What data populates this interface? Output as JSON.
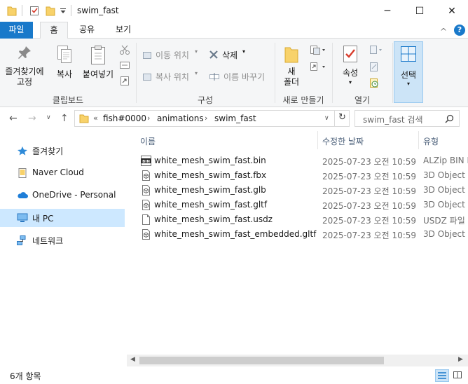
{
  "window": {
    "title": "swim_fast",
    "controls": {
      "minimize": "─",
      "maximize": "☐",
      "close": "✕"
    }
  },
  "ribbon": {
    "tabs": [
      {
        "label": "파일"
      },
      {
        "label": "홈"
      },
      {
        "label": "공유"
      },
      {
        "label": "보기"
      }
    ],
    "collapse_label": "^",
    "help_label": "?",
    "groups": {
      "clipboard": {
        "label": "클립보드",
        "pin": [
          "즐겨찾기에",
          "고정"
        ],
        "copy": "복사",
        "paste": "붙여넣기"
      },
      "organize": {
        "label": "구성",
        "move_to": "이동 위치",
        "copy_to": "복사 위치",
        "delete": "삭제",
        "rename": "이름 바꾸기"
      },
      "new": {
        "label": "새로 만들기",
        "new_folder": [
          "새",
          "폴더"
        ]
      },
      "open": {
        "label": "열기",
        "properties": "속성"
      },
      "select": {
        "label": "선택"
      }
    }
  },
  "address": {
    "overflow": "«",
    "crumbs": [
      "fish#0000",
      "animations",
      "swim_fast"
    ],
    "search_placeholder": "swim_fast 검색"
  },
  "sidebar": {
    "items": [
      {
        "label": "즐겨찾기",
        "icon": "star-icon"
      },
      {
        "label": "Naver Cloud",
        "icon": "drive-icon"
      },
      {
        "label": "OneDrive - Personal",
        "icon": "cloud-icon"
      },
      {
        "label": "내 PC",
        "icon": "pc-icon",
        "selected": true
      },
      {
        "label": "네트워크",
        "icon": "network-icon"
      }
    ]
  },
  "files": {
    "columns": {
      "name": "이름",
      "date": "수정한 날짜",
      "type": "유형"
    },
    "rows": [
      {
        "name": "white_mesh_swim_fast.bin",
        "date": "2025-07-23 오전 10:59",
        "type": "ALZip BIN File",
        "icon": "bin-file-icon"
      },
      {
        "name": "white_mesh_swim_fast.fbx",
        "date": "2025-07-23 오전 10:59",
        "type": "3D Object",
        "icon": "3d-object-icon"
      },
      {
        "name": "white_mesh_swim_fast.glb",
        "date": "2025-07-23 오전 10:59",
        "type": "3D Object",
        "icon": "3d-object-icon"
      },
      {
        "name": "white_mesh_swim_fast.gltf",
        "date": "2025-07-23 오전 10:59",
        "type": "3D Object",
        "icon": "3d-object-icon"
      },
      {
        "name": "white_mesh_swim_fast.usdz",
        "date": "2025-07-23 오전 10:59",
        "type": "USDZ 파일",
        "icon": "blank-file-icon"
      },
      {
        "name": "white_mesh_swim_fast_embedded.gltf",
        "date": "2025-07-23 오전 10:59",
        "type": "3D Object",
        "icon": "3d-object-icon"
      }
    ]
  },
  "status": {
    "item_count": "6개 항목"
  },
  "colors": {
    "accent": "#1979ca",
    "selection": "#cde8ff",
    "ribbon_bg": "#f5f6f7"
  }
}
